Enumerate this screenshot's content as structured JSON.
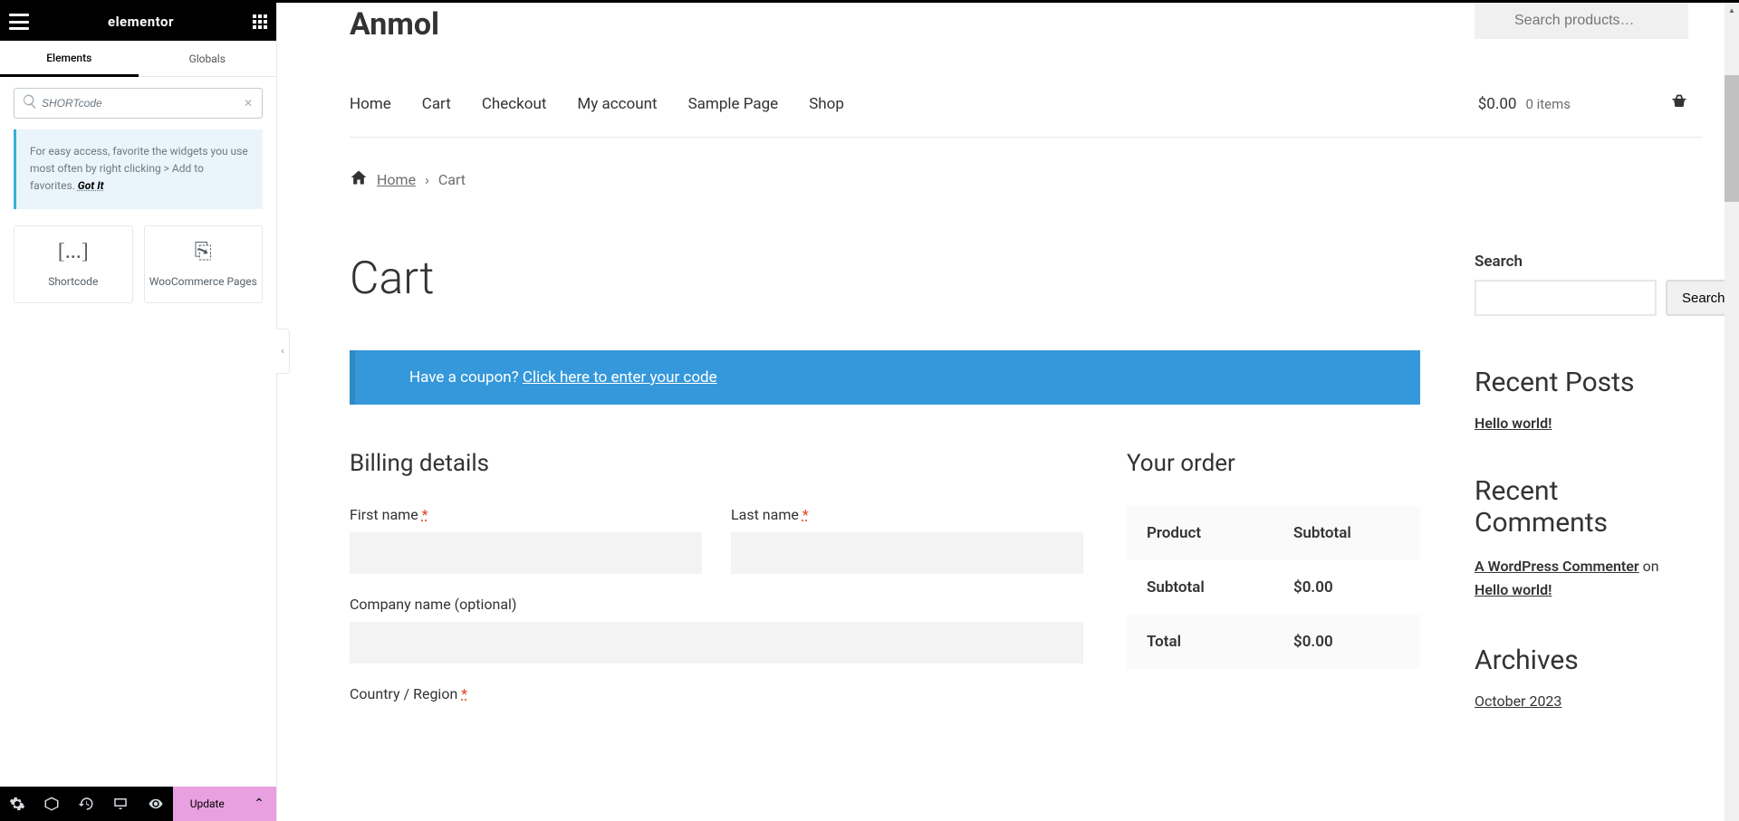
{
  "sidebar": {
    "logo": "elementor",
    "tabs": {
      "elements": "Elements",
      "globals": "Globals"
    },
    "search_value": "SHORTcode",
    "tip": "For easy access, favorite the widgets you use most often by right clicking > Add to favorites. ",
    "tip_gotit": "Got It",
    "widgets": [
      {
        "icon": "[...]",
        "label": "Shortcode"
      },
      {
        "icon": "⎘",
        "label": "WooCommerce Pages"
      }
    ],
    "update": "Update"
  },
  "site": {
    "title": "Anmol",
    "search_placeholder": "Search products…",
    "nav": [
      "Home",
      "Cart",
      "Checkout",
      "My account",
      "Sample Page",
      "Shop"
    ],
    "cart_price": "$0.00",
    "cart_items": "0 items"
  },
  "breadcrumb": {
    "home": "Home",
    "current": "Cart"
  },
  "page": {
    "title": "Cart",
    "coupon_prefix": "Have a coupon? ",
    "coupon_link": "Click here to enter your code",
    "billing_h": "Billing details",
    "order_h": "Your order",
    "fields": {
      "first": "First name ",
      "last": "Last name ",
      "company": "Company name (optional)",
      "country": "Country / Region "
    },
    "order_table": {
      "th1": "Product",
      "th2": "Subtotal",
      "subtotal_l": "Subtotal",
      "subtotal_v": "$0.00",
      "total_l": "Total",
      "total_v": "$0.00"
    }
  },
  "aside": {
    "search_label": "Search",
    "search_btn": "Search",
    "recent_posts_h": "Recent Posts",
    "recent_post1": "Hello world!",
    "recent_comments_h": "Recent Comments",
    "commenter": "A WordPress Commenter",
    "on": " on ",
    "comment_post": "Hello world!",
    "archives_h": "Archives",
    "archive1": "October 2023"
  }
}
